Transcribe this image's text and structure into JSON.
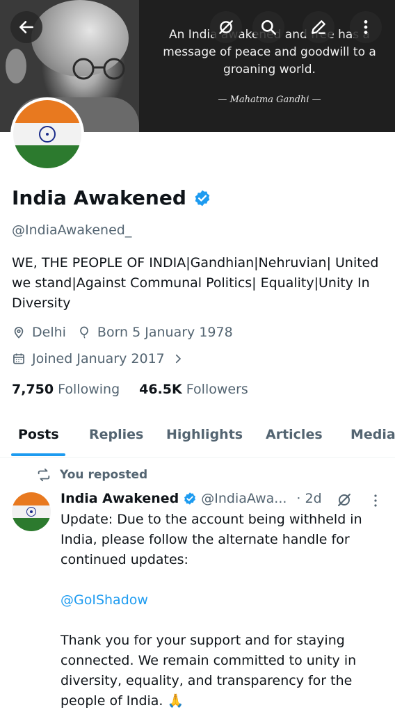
{
  "banner": {
    "quote": "An India awakened and free has a message of peace and goodwill to a groaning world.",
    "author": "— Mahatma Gandhi —"
  },
  "profile": {
    "name": "India Awakened",
    "handle": "@IndiaAwakened_",
    "bio": "WE, THE PEOPLE OF INDIA|Gandhian|Nehruvian| United we stand|Against Communal Politics| Equality|Unity In Diversity",
    "location": "Delhi",
    "born": "Born 5 January 1978",
    "joined": "Joined January 2017",
    "following_count": "7,750",
    "following_label": "Following",
    "followers_count": "46.5K",
    "followers_label": "Followers"
  },
  "tabs": [
    "Posts",
    "Replies",
    "Highlights",
    "Articles",
    "Media"
  ],
  "post": {
    "repost_label": "You reposted",
    "author_name": "India Awakened",
    "author_handle": "@IndiaAwa...",
    "time": "· 2d",
    "paragraph1": "Update: Due to the account being withheld in India, please follow the alternate handle for continued updates:",
    "link": "@GoIShadow",
    "paragraph2": "Thank you for your support and for staying connected. We remain committed to unity in diversity, equality, and transparency for the people of India. 🙏"
  },
  "icons": {
    "back": "back-arrow-icon",
    "grok": "grok-icon",
    "search": "search-icon",
    "edit": "edit-icon",
    "more": "more-vertical-icon"
  },
  "colors": {
    "accent": "#1d9bf0",
    "text": "#0f1419",
    "muted": "#536471",
    "saffron": "#e8791f",
    "green": "#2c7a2e"
  }
}
